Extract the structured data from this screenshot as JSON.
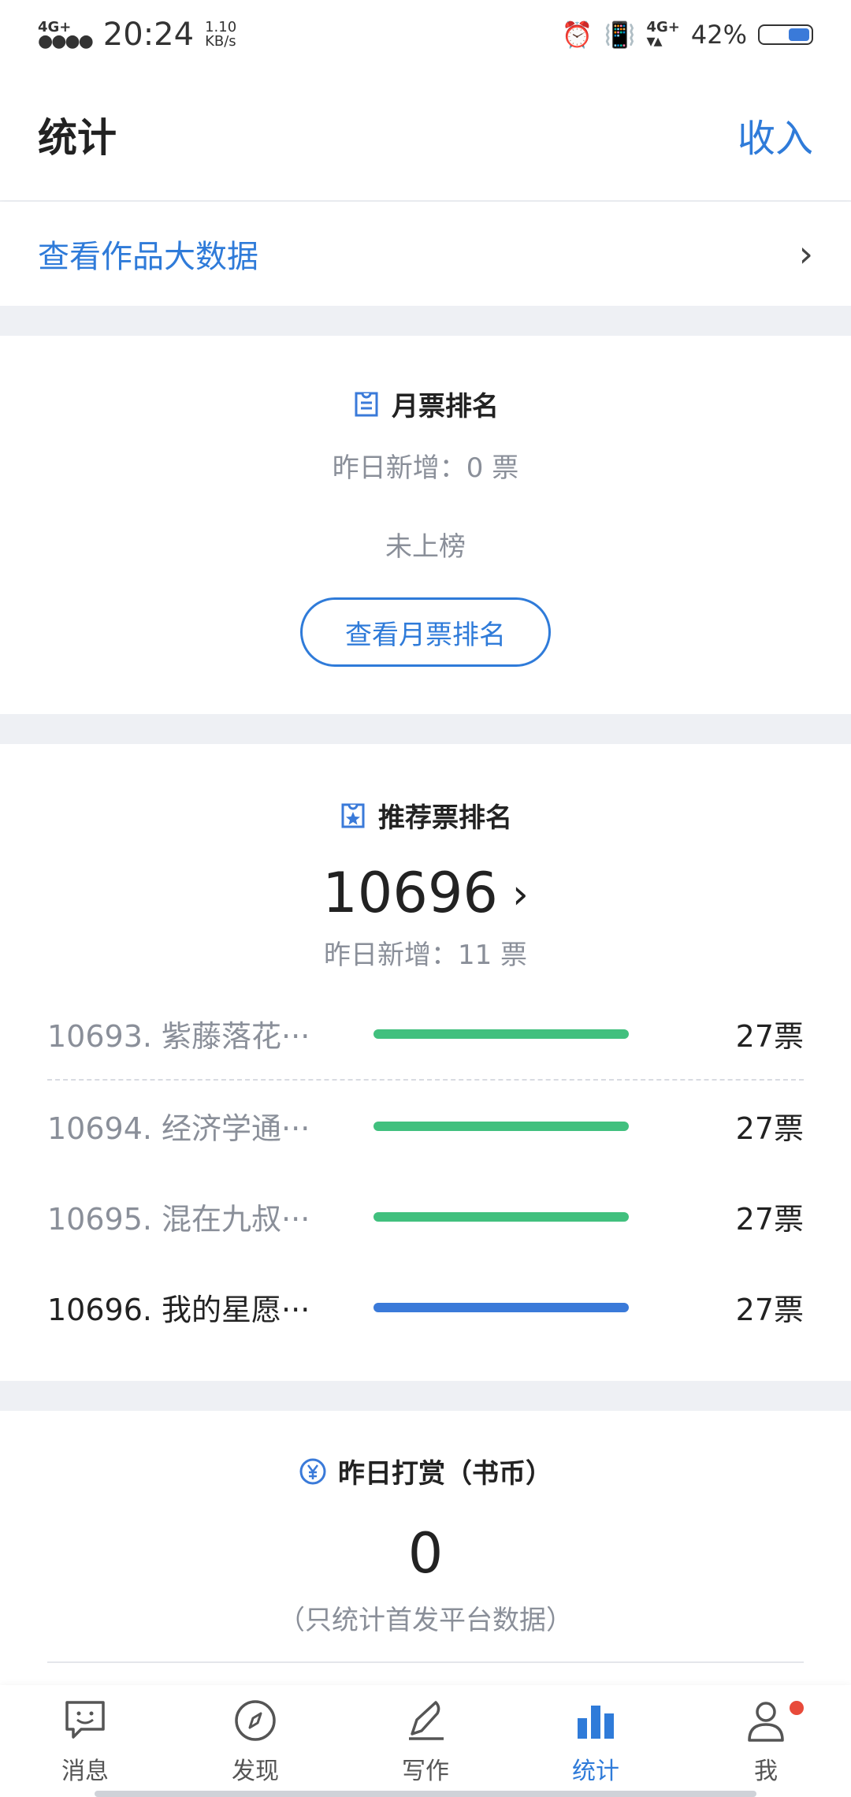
{
  "status_bar": {
    "network_label": "4G+",
    "time": "20:24",
    "speed_value": "1.10",
    "speed_unit": "KB/s",
    "network2_label": "4G+",
    "battery_percent": "42%",
    "battery_level": 0.42
  },
  "header": {
    "title": "统计",
    "right_link": "收入"
  },
  "big_data": {
    "label": "查看作品大数据"
  },
  "monthly_ticket": {
    "title": "月票排名",
    "sub_label": "昨日新增：0 票",
    "status": "未上榜",
    "button_label": "查看月票排名"
  },
  "recommend_ticket": {
    "title": "推荐票排名",
    "rank": "10696",
    "sub_label": "昨日新增：11 票",
    "list": [
      {
        "name": "10693. 紫藤落花···",
        "votes": "27票",
        "bar_level": 1.0,
        "color": "#41c07e"
      },
      {
        "name": "10694. 经济学通···",
        "votes": "27票",
        "bar_level": 1.0,
        "color": "#41c07e"
      },
      {
        "name": "10695. 混在九叔···",
        "votes": "27票",
        "bar_level": 1.0,
        "color": "#41c07e"
      },
      {
        "name": "10696. 我的星愿···",
        "votes": "27票",
        "bar_level": 1.0,
        "color": "#3a7ad9"
      }
    ]
  },
  "reward": {
    "title": "昨日打赏（书币）",
    "value": "0",
    "note": "（只统计首发平台数据）"
  },
  "bottom_nav": {
    "items": [
      {
        "label": "消息",
        "icon": "message-icon"
      },
      {
        "label": "发现",
        "icon": "compass-icon"
      },
      {
        "label": "写作",
        "icon": "pen-icon"
      },
      {
        "label": "统计",
        "icon": "bar-chart-icon"
      },
      {
        "label": "我",
        "icon": "user-icon"
      }
    ],
    "active_index": 3
  },
  "colors": {
    "accent": "#2f7bd9",
    "green_bar": "#41c07e",
    "blue_bar": "#3a7ad9",
    "badge_red": "#e84a3a"
  }
}
